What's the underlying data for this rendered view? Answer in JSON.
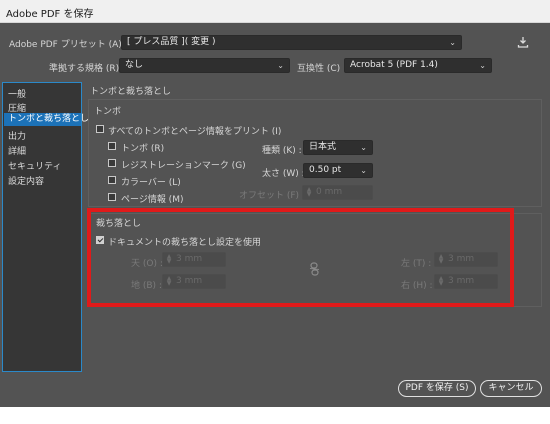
{
  "window": {
    "title": "Adobe PDF を保存",
    "download_icon": "download-icon"
  },
  "preset": {
    "label": "Adobe PDF プリセット (A) :",
    "value": "[ プレス品質 ]( 変更 )"
  },
  "standard": {
    "label": "準拠する規格 (R) :",
    "value": "なし"
  },
  "compatibility": {
    "label": "互換性 (C) :",
    "value": "Acrobat 5 (PDF 1.4)"
  },
  "sidebar": {
    "items": [
      {
        "label": "一般"
      },
      {
        "label": "圧縮"
      },
      {
        "label": "トンボと裁ち落とし"
      },
      {
        "label": "出力"
      },
      {
        "label": "詳細"
      },
      {
        "label": "セキュリティ"
      },
      {
        "label": "設定内容"
      }
    ],
    "selected_index": 2
  },
  "section_title": "トンボと裁ち落とし",
  "marks": {
    "group_label": "トンボ",
    "all_marks_label": "すべてのトンボとページ情報をプリント (I)",
    "all_marks_checked": false,
    "trim_label": "トンボ (R)",
    "trim_checked": false,
    "registration_label": "レジストレーションマーク (G)",
    "registration_checked": false,
    "color_bars_label": "カラーバー (L)",
    "color_bars_checked": false,
    "page_info_label": "ページ情報 (M)",
    "page_info_checked": false,
    "type_label": "種類 (K) :",
    "type_value": "日本式",
    "weight_label": "太さ (W) :",
    "weight_value": "0.50 pt",
    "offset_label": "オフセット (F) :",
    "offset_value": "0 mm"
  },
  "bleed": {
    "group_label": "裁ち落とし",
    "use_doc_label": "ドキュメントの裁ち落とし設定を使用",
    "use_doc_checked": true,
    "top_label": "天 (O) :",
    "top_value": "3 mm",
    "bottom_label": "地 (B) :",
    "bottom_value": "3 mm",
    "left_label": "左 (T) :",
    "left_value": "3 mm",
    "right_label": "右 (H) :",
    "right_value": "3 mm",
    "link_icon": "link-icon"
  },
  "buttons": {
    "save_label": "PDF を保存 (S)",
    "cancel_label": "キャンセル"
  },
  "highlight_color": "#e01a1a",
  "accent_color": "#1c72b8"
}
